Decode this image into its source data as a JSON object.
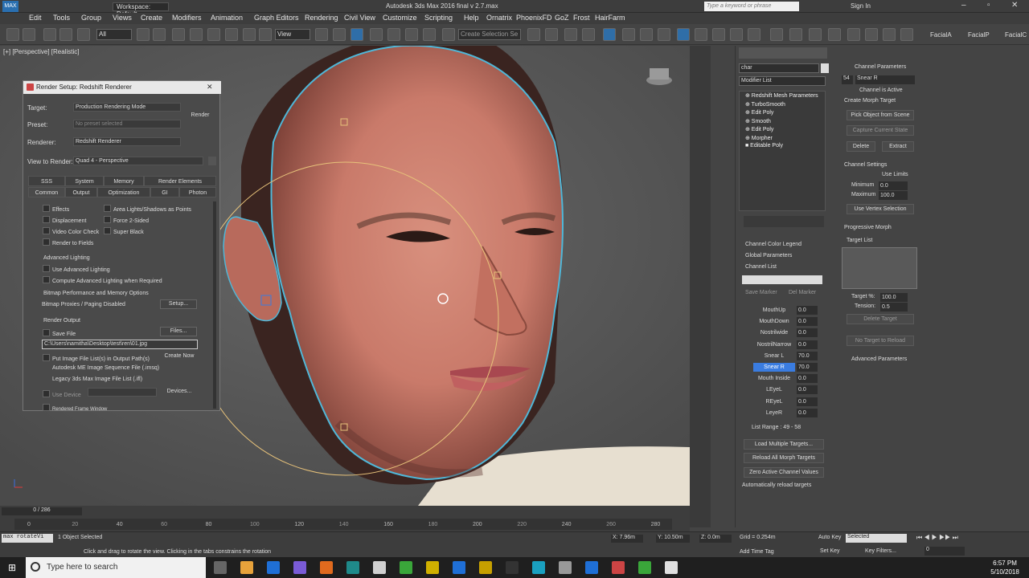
{
  "app": {
    "title": "Autodesk 3ds Max 2016     final v 2.7.max",
    "workspace": "Workspace: Default",
    "search_placeholder": "Type a keyword or phrase",
    "signin": "Sign In"
  },
  "menu": [
    "Edit",
    "Tools",
    "Group",
    "Views",
    "Create",
    "Modifiers",
    "Animation",
    "Graph Editors",
    "Rendering",
    "Civil View",
    "Customize",
    "Scripting",
    "Help",
    "Ornatrix",
    "PhoenixFD",
    "GoZ",
    "Frost",
    "HairFarm"
  ],
  "toolbar": {
    "filter": "All",
    "view": "View",
    "selection_set": "Create Selection Se",
    "right_labels": [
      "FacialA",
      "FacialP",
      "FacialC"
    ]
  },
  "viewport": {
    "label": "[+] [Perspective] [Realistic]"
  },
  "render_setup": {
    "title": "Render Setup: Redshift Renderer",
    "target_label": "Target:",
    "target_value": "Production Rendering Mode",
    "preset_label": "Preset:",
    "preset_value": "No preset selected",
    "renderer_label": "Renderer:",
    "renderer_value": "Redshift Renderer",
    "view_label": "View to Render:",
    "view_value": "Quad 4 - Perspective",
    "render_button": "Render",
    "tabs_row1": [
      "SSS",
      "System",
      "Memory",
      "Render Elements"
    ],
    "tabs_row2": [
      "Common",
      "Output",
      "Optimization",
      "GI",
      "Photon"
    ],
    "options": {
      "effects": "Effects",
      "displacement": "Displacement",
      "video_color": "Video Color Check",
      "render_fields": "Render to Fields",
      "area_lights": "Area Lights/Shadows as Points",
      "force_2sided": "Force 2-Sided",
      "super_black": "Super Black"
    },
    "adv_lighting_group": "Advanced Lighting",
    "use_adv_lighting": "Use Advanced Lighting",
    "compute_adv": "Compute Advanced Lighting when Required",
    "bitmap_group": "Bitmap Performance and Memory Options",
    "bitmap_proxies": "Bitmap Proxies / Paging Disabled",
    "setup_button": "Setup...",
    "render_output_group": "Render Output",
    "save_file": "Save File",
    "files_button": "Files...",
    "output_path": "C:\\Users\\namitha\\Desktop\\test\\ren\\01.jpg",
    "put_image": "Put Image File List(s) in Output Path(s)",
    "create_now": "Create Now",
    "autodesk_seq": "Autodesk ME Image Sequence File (.imsq)",
    "legacy_seq": "Legacy 3ds Max Image File List (.ifl)",
    "use_device": "Use Device",
    "devices_button": "Devices...",
    "rendered_frame": "Rendered Frame Window"
  },
  "modifier_panel": {
    "object_name": "char",
    "modifier_list": "Modifier List",
    "stack": [
      "Redshift Mesh Parameters",
      "TurboSmooth",
      "Edit Poly",
      "Smooth",
      "Edit Poly",
      "Morpher",
      "Editable Poly"
    ],
    "rollouts": [
      "Channel Color Legend",
      "Global Parameters",
      "Channel List"
    ],
    "save_marker": "Save Marker",
    "del_marker": "Del Marker",
    "channels": [
      {
        "name": "MouthUp",
        "value": "0.0"
      },
      {
        "name": "MouthDown",
        "value": "0.0"
      },
      {
        "name": "Nostrilwide",
        "value": "0.0"
      },
      {
        "name": "NostrilNarrow",
        "value": "0.0"
      },
      {
        "name": "Snear L",
        "value": "70.0"
      },
      {
        "name": "Snear R",
        "value": "70.0"
      },
      {
        "name": "Mouth Inside",
        "value": "0.0"
      },
      {
        "name": "LEyeL",
        "value": "0.0"
      },
      {
        "name": "REyeL",
        "value": "0.0"
      },
      {
        "name": "LeyeR",
        "value": "0.0"
      }
    ],
    "list_range": "List Range :  49 - 58",
    "load_multiple": "Load Multiple Targets...",
    "reload_all": "Reload All Morph Targets",
    "zero_active": "Zero Active Channel Values",
    "auto_reload": "Automatically reload targets"
  },
  "channel_params": {
    "header": "Channel Parameters",
    "channel_num": "54",
    "channel_name": "Snear R",
    "is_active": "Channel is Active",
    "create_group": "Create Morph Target",
    "pick_object": "Pick Object from Scene",
    "capture_state": "Capture Current State",
    "delete": "Delete",
    "extract": "Extract",
    "settings_group": "Channel Settings",
    "use_limits": "Use Limits",
    "minimum_label": "Minimum",
    "minimum": "0.0",
    "maximum_label": "Maximum",
    "maximum": "100.0",
    "use_vertex": "Use Vertex Selection",
    "progressive_group": "Progressive Morph",
    "target_list": "Target List",
    "target_pct_label": "Target %:",
    "target_pct": "100.0",
    "tension_label": "Tension:",
    "tension": "0.5",
    "delete_target": "Delete Target",
    "no_target": "No Target to Reload",
    "advanced": "Advanced Parameters"
  },
  "timeline": {
    "frame": "0 / 286",
    "ticks": [
      "0",
      "40",
      "80",
      "120",
      "160",
      "200",
      "240",
      "280"
    ],
    "ticks_minor": [
      "20",
      "60",
      "100",
      "140",
      "180",
      "220",
      "260"
    ]
  },
  "status": {
    "maxscript": "max rotateVi",
    "selected": "1 Object Selected",
    "prompt": "Click and drag to rotate the view. Clicking in the tabs constrains the rotation",
    "x": "X: 7.96m",
    "y": "Y: 10.50m",
    "z": "Z: 0.0m",
    "grid": "Grid = 0.254m",
    "add_time_tag": "Add Time Tag",
    "auto_key": "Auto Key",
    "set_key": "Set Key",
    "selected_dd": "Selected",
    "key_filters": "Key Filters...",
    "frame_val": "0"
  },
  "taskbar": {
    "search": "Type here to search",
    "time": "6:57 PM",
    "date": "5/10/2018"
  }
}
